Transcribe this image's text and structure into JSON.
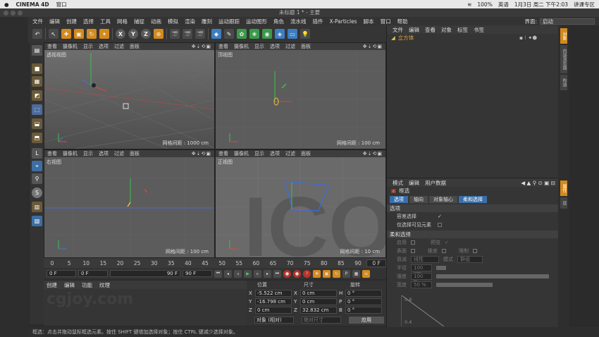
{
  "macbar": {
    "apple": "",
    "app": "CINEMA 4D",
    "window": "窗口",
    "battery": "100%",
    "input": "英语",
    "datetime": "1月3日 周二 下午2:03",
    "user": "讲课专区"
  },
  "title": "未标题 1 * - 主要",
  "menu": [
    "文件",
    "编辑",
    "创建",
    "选择",
    "工具",
    "网格",
    "捕捉",
    "动画",
    "模拟",
    "渲染",
    "雕刻",
    "运动跟踪",
    "运动图形",
    "角色",
    "流水线",
    "插件",
    "X-Particles",
    "脚本",
    "窗口",
    "帮助"
  ],
  "layout": {
    "label": "界面:",
    "value": "启动"
  },
  "toolbar": {
    "undo": "↶",
    "x": "X",
    "y": "Y",
    "z": "Z"
  },
  "viewports": [
    {
      "menu": [
        "查看",
        "摄像机",
        "显示",
        "选项",
        "过滤",
        "面板"
      ],
      "label": "透视视图",
      "grid": "网格间距 : 1000 cm"
    },
    {
      "menu": [
        "查看",
        "摄像机",
        "显示",
        "选项",
        "过滤",
        "面板"
      ],
      "label": "顶视图",
      "grid": "网格间距 : 100 cm"
    },
    {
      "menu": [
        "查看",
        "摄像机",
        "显示",
        "选项",
        "过滤",
        "面板"
      ],
      "label": "右视图",
      "grid": "网格间距 : 100 cm"
    },
    {
      "menu": [
        "查看",
        "摄像机",
        "显示",
        "选项",
        "过滤",
        "面板"
      ],
      "label": "正视图",
      "grid": "网格间距 : 10 cm"
    }
  ],
  "timeline": {
    "ticks": [
      "0",
      "5",
      "10",
      "15",
      "20",
      "25",
      "30",
      "35",
      "40",
      "45",
      "50",
      "55",
      "60",
      "65",
      "70",
      "75",
      "80",
      "85",
      "90"
    ],
    "end_label": "0 F",
    "start": "0 F",
    "min": "0 F",
    "max": "90 F",
    "max2": "90 F"
  },
  "material": {
    "menu": [
      "创建",
      "编辑",
      "功能",
      "纹理"
    ]
  },
  "coords": {
    "headers": [
      "位置",
      "尺寸",
      "旋转"
    ],
    "rows": [
      {
        "a": "X",
        "pos": "-5.522 cm",
        "b": "X",
        "size": "0 cm",
        "c": "H",
        "rot": "0 °"
      },
      {
        "a": "Y",
        "pos": "-16.798 cm",
        "b": "Y",
        "size": "0 cm",
        "c": "P",
        "rot": "0 °"
      },
      {
        "a": "Z",
        "pos": "0 cm",
        "b": "Z",
        "size": "32.832 cm",
        "c": "B",
        "rot": "0 °"
      }
    ],
    "mode": "对象 (相对)",
    "size_mode": "绝对尺寸",
    "apply": "应用"
  },
  "objects": {
    "menu": [
      "文件",
      "编辑",
      "查看",
      "对象",
      "标签",
      "书签"
    ],
    "items": [
      {
        "name": "立方体"
      }
    ]
  },
  "attributes": {
    "menu": [
      "模式",
      "编辑",
      "用户数据"
    ],
    "tool": "框选",
    "tabs": [
      "选项",
      "轴向",
      "对象轴心",
      "柔和选择"
    ],
    "section1": "选项",
    "opt1": "容差选择",
    "opt2": "仅选择可见元素",
    "section2": "柔和选择",
    "soft": [
      {
        "l": "启用",
        "r": "预览"
      },
      {
        "l": "表面",
        "r": "橡皮",
        "r2": "限制"
      },
      {
        "l": "衰减",
        "v": "线性",
        "r": "模式",
        "v2": "群组"
      },
      {
        "l": "半径",
        "v": "100 cm"
      },
      {
        "l": "强度",
        "v": "100 %"
      },
      {
        "l": "宽度",
        "v": "50 %"
      }
    ],
    "graph_ticks": [
      "0.8",
      "0.4"
    ]
  },
  "right_tabs": [
    "对象",
    "内容浏览器",
    "构造",
    "层"
  ],
  "status": "框选：点击并拖动鼠标框选元素。按住 SHIFT 键增加选择对象；按住 CTRL 键减少选择对象。",
  "watermark": "cgjoy.com"
}
